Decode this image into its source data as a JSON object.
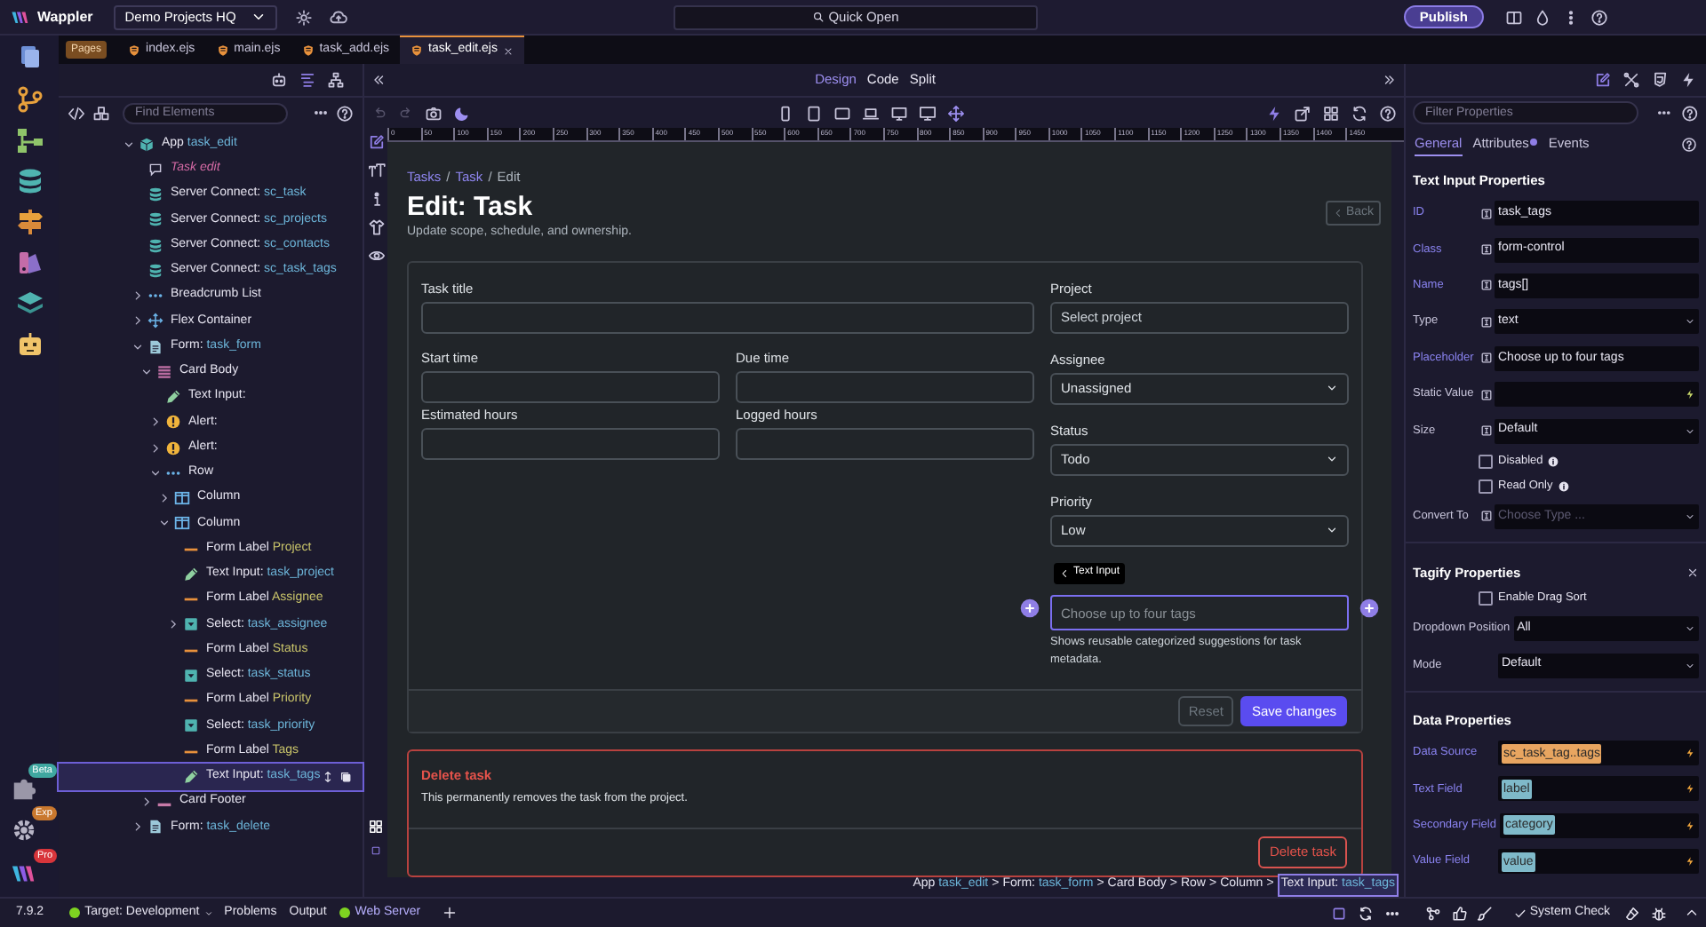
{
  "app": {
    "name": "Wappler",
    "project": "Demo Projects HQ",
    "quick_open": "Quick Open",
    "publish": "Publish"
  },
  "rail_badges": [
    "Beta",
    "Exp",
    "Pro"
  ],
  "file_tabs": {
    "group": "Pages",
    "tabs": [
      {
        "label": "index.ejs",
        "selected": false
      },
      {
        "label": "main.ejs",
        "selected": false
      },
      {
        "label": "task_add.ejs",
        "selected": false
      },
      {
        "label": "task_edit.ejs",
        "selected": true
      }
    ]
  },
  "structure": {
    "search_placeholder": "Find Elements",
    "tree": [
      {
        "kind": "app",
        "label": "App",
        "name": "task_edit",
        "expanded": true,
        "selected": false,
        "children": [
          {
            "kind": "comment",
            "label": "Task edit",
            "selected": false
          },
          {
            "kind": "server",
            "label": "Server Connect:",
            "name": "sc_task",
            "selected": false
          },
          {
            "kind": "server",
            "label": "Server Connect:",
            "name": "sc_projects",
            "selected": false
          },
          {
            "kind": "server",
            "label": "Server Connect:",
            "name": "sc_contacts",
            "selected": false
          },
          {
            "kind": "server",
            "label": "Server Connect:",
            "name": "sc_task_tags",
            "selected": false
          },
          {
            "kind": "dots",
            "label": "Breadcrumb List",
            "expanded": false,
            "selected": false
          },
          {
            "kind": "flex",
            "label": "Flex Container",
            "expanded": false,
            "selected": false
          },
          {
            "kind": "form",
            "label": "Form:",
            "name": "task_form",
            "expanded": true,
            "selected": false,
            "children": [
              {
                "kind": "card",
                "label": "Card Body",
                "expanded": true,
                "selected": false,
                "children": [
                  {
                    "kind": "input",
                    "label": "Text Input:",
                    "selected": false
                  },
                  {
                    "kind": "alert",
                    "label": "Alert:",
                    "expanded": false,
                    "selected": false
                  },
                  {
                    "kind": "alert",
                    "label": "Alert:",
                    "expanded": false,
                    "selected": false
                  },
                  {
                    "kind": "dots",
                    "label": "Row",
                    "expanded": true,
                    "selected": false,
                    "children": [
                      {
                        "kind": "column",
                        "label": "Column",
                        "expanded": false,
                        "selected": false
                      },
                      {
                        "kind": "column",
                        "label": "Column",
                        "expanded": true,
                        "selected": false,
                        "children": [
                          {
                            "kind": "label",
                            "label": "Form Label",
                            "name": "Project",
                            "selected": false
                          },
                          {
                            "kind": "input",
                            "label": "Text Input:",
                            "name": "task_project",
                            "selected": false
                          },
                          {
                            "kind": "label",
                            "label": "Form Label",
                            "name": "Assignee",
                            "selected": false
                          },
                          {
                            "kind": "select",
                            "label": "Select:",
                            "name": "task_assignee",
                            "expanded": false,
                            "selected": false
                          },
                          {
                            "kind": "label",
                            "label": "Form Label",
                            "name": "Status",
                            "selected": false
                          },
                          {
                            "kind": "select",
                            "label": "Select:",
                            "name": "task_status",
                            "selected": false
                          },
                          {
                            "kind": "label",
                            "label": "Form Label",
                            "name": "Priority",
                            "selected": false
                          },
                          {
                            "kind": "select",
                            "label": "Select:",
                            "name": "task_priority",
                            "selected": false
                          },
                          {
                            "kind": "label",
                            "label": "Form Label",
                            "name": "Tags",
                            "selected": false
                          },
                          {
                            "kind": "input",
                            "label": "Text Input:",
                            "name": "task_tags",
                            "selected": true
                          }
                        ]
                      }
                    ]
                  }
                ]
              },
              {
                "kind": "footer",
                "label": "Card Footer",
                "expanded": false,
                "selected": false
              }
            ]
          },
          {
            "kind": "form",
            "label": "Form:",
            "name": "task_delete",
            "expanded": false,
            "selected": false
          }
        ]
      }
    ]
  },
  "view_modes": [
    {
      "label": "Design",
      "selected": true
    },
    {
      "label": "Code",
      "selected": false
    },
    {
      "label": "Split",
      "selected": false
    }
  ],
  "ruler": [
    "0",
    "50",
    "100",
    "150",
    "200",
    "250",
    "300",
    "350",
    "400",
    "450",
    "500",
    "550",
    "600",
    "650",
    "700",
    "750",
    "800",
    "850",
    "900",
    "950",
    "1000",
    "1050",
    "1100",
    "1150",
    "1200",
    "1250",
    "1300",
    "1350",
    "1400",
    "1450"
  ],
  "page": {
    "breadcrumb": [
      {
        "kind": "link",
        "label": "Tasks"
      },
      {
        "kind": "separator",
        "label": "/"
      },
      {
        "kind": "link",
        "label": "Task"
      },
      {
        "kind": "separator",
        "label": "/"
      },
      {
        "kind": "current",
        "label": "Edit"
      }
    ],
    "title": "Edit: Task",
    "subtitle": "Update scope, schedule, and ownership.",
    "back_button": "Back",
    "left_rows": [
      [
        {
          "label": "Task title"
        }
      ],
      [
        {
          "label": "Start time"
        },
        {
          "label": "Due time"
        }
      ],
      [
        {
          "label": "Estimated hours"
        },
        {
          "label": "Logged hours"
        }
      ]
    ],
    "right_fields": [
      {
        "kind": "input",
        "label": "Project",
        "placeholder": "Select project"
      },
      {
        "kind": "select",
        "label": "Assignee",
        "value": "Unassigned"
      },
      {
        "kind": "select",
        "label": "Status",
        "value": "Todo"
      },
      {
        "kind": "select",
        "label": "Priority",
        "value": "Low"
      },
      {
        "kind": "tags",
        "tooltip": "Text Input",
        "placeholder": "Choose up to four tags",
        "help": "Shows reusable categorized suggestions for task metadata.",
        "selected": true
      }
    ],
    "footer_buttons": [
      {
        "kind": "secondary",
        "label": "Reset",
        "disabled": true
      },
      {
        "kind": "primary",
        "label": "Save changes",
        "disabled": false
      }
    ],
    "danger_card": {
      "title": "Delete task",
      "text": "This permanently removes the task from the project.",
      "button": "Delete task"
    }
  },
  "element_path": [
    {
      "kind": "item",
      "label": "App",
      "name": "task_edit",
      "selected": false
    },
    {
      "kind": "separator",
      "label": ">"
    },
    {
      "kind": "item",
      "label": "Form:",
      "name": "task_form",
      "selected": false
    },
    {
      "kind": "separator",
      "label": ">"
    },
    {
      "kind": "item",
      "label": "Card Body",
      "selected": false
    },
    {
      "kind": "separator",
      "label": ">"
    },
    {
      "kind": "item",
      "label": "Row",
      "selected": false
    },
    {
      "kind": "separator",
      "label": ">"
    },
    {
      "kind": "item",
      "label": "Column",
      "selected": false
    },
    {
      "kind": "separator",
      "label": ">"
    },
    {
      "kind": "item",
      "label": "Text Input:",
      "name": "task_tags",
      "selected": true
    }
  ],
  "properties": {
    "filter_placeholder": "Filter Properties",
    "tabs": [
      {
        "label": "General",
        "selected": true,
        "dot": false
      },
      {
        "label": "Attributes",
        "selected": false,
        "dot": true
      },
      {
        "label": "Events",
        "selected": false,
        "dot": false
      }
    ],
    "sections": [
      {
        "title": "Text Input Properties",
        "rows": [
          {
            "kind": "text",
            "label": "ID",
            "value": "task_tags",
            "modified": true,
            "data_picker": true
          },
          {
            "kind": "text",
            "label": "Class",
            "value": "form-control",
            "modified": true,
            "data_picker": true
          },
          {
            "kind": "text",
            "label": "Name",
            "value": "tags[]",
            "modified": true,
            "data_picker": true
          },
          {
            "kind": "select",
            "label": "Type",
            "value": "text",
            "modified": false,
            "data_picker": true
          },
          {
            "kind": "text",
            "label": "Placeholder",
            "value": "Choose up to four tags",
            "modified": true,
            "data_picker": true
          },
          {
            "kind": "dynamic",
            "label": "Static Value",
            "modified": false,
            "data_picker": true
          },
          {
            "kind": "select",
            "label": "Size",
            "value": "Default",
            "modified": false,
            "data_picker": true
          },
          {
            "kind": "checkbox",
            "label": "Disabled",
            "checked": false
          },
          {
            "kind": "checkbox",
            "label": "Read Only",
            "checked": false
          },
          {
            "kind": "select",
            "label": "Convert To",
            "placeholder": "Choose Type ...",
            "modified": false,
            "data_picker": true
          }
        ]
      },
      {
        "title": "Tagify Properties",
        "closable": true,
        "rows": [
          {
            "kind": "checkbox",
            "label": "Enable Drag Sort",
            "checked": false
          },
          {
            "kind": "select",
            "label": "Dropdown Position",
            "value": "All",
            "modified": false
          },
          {
            "kind": "select",
            "label": "Mode",
            "value": "Default",
            "modified": false
          }
        ]
      },
      {
        "title": "Data Properties",
        "rows": [
          {
            "kind": "binding",
            "label": "Data Source",
            "value": "sc_task_tag..tags",
            "color": "#e8a560",
            "modified": true
          },
          {
            "kind": "binding",
            "label": "Text Field",
            "value": "label",
            "color": "#7fb9c9",
            "modified": true
          },
          {
            "kind": "binding",
            "label": "Secondary Field",
            "value": "category",
            "color": "#7fb9c9",
            "modified": true
          },
          {
            "kind": "binding",
            "label": "Value Field",
            "value": "value",
            "color": "#7fb9c9",
            "modified": true
          }
        ]
      }
    ]
  },
  "status_bar": {
    "version": "7.9.2",
    "target": "Target: Development",
    "items": [
      "Problems",
      "Output"
    ],
    "server": "Web Server",
    "system_check": "System Check"
  }
}
